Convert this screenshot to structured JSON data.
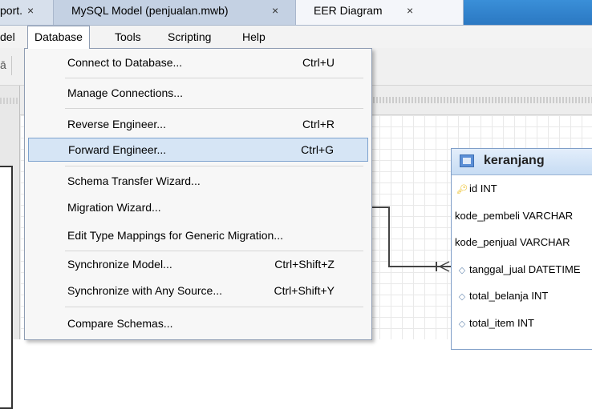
{
  "tabs": [
    {
      "label": "port.",
      "close": "×"
    },
    {
      "label": "MySQL Model (penjualan.mwb)",
      "close": "×"
    },
    {
      "label": "EER Diagram",
      "close": "×"
    }
  ],
  "menubar": {
    "items": [
      {
        "label": "del"
      },
      {
        "label": "Database"
      },
      {
        "label": "Tools"
      },
      {
        "label": "Scripting"
      },
      {
        "label": "Help"
      }
    ]
  },
  "toolbar": {
    "glyph": "ā"
  },
  "database_menu": {
    "items": [
      {
        "label": "Connect to Database...",
        "shortcut": "Ctrl+U"
      },
      {
        "label": "Manage Connections...",
        "shortcut": ""
      },
      {
        "label": "Reverse Engineer...",
        "shortcut": "Ctrl+R"
      },
      {
        "label": "Forward Engineer...",
        "shortcut": "Ctrl+G"
      },
      {
        "label": "Schema Transfer Wizard...",
        "shortcut": ""
      },
      {
        "label": "Migration Wizard...",
        "shortcut": ""
      },
      {
        "label": "Edit Type Mappings for Generic Migration...",
        "shortcut": ""
      },
      {
        "label": "Synchronize Model...",
        "shortcut": "Ctrl+Shift+Z"
      },
      {
        "label": "Synchronize with Any Source...",
        "shortcut": "Ctrl+Shift+Y"
      },
      {
        "label": "Compare Schemas...",
        "shortcut": ""
      }
    ],
    "highlighted": "Forward Engineer..."
  },
  "entity": {
    "title": "keranjang",
    "columns": [
      {
        "icon": "key-icon",
        "text": "id INT"
      },
      {
        "icon": "none",
        "text": "kode_pembeli VARCHAR"
      },
      {
        "icon": "none",
        "text": "kode_penjual VARCHAR"
      },
      {
        "icon": "diamond-icon",
        "text": "tanggal_jual DATETIME"
      },
      {
        "icon": "diamond-icon",
        "text": "total_belanja INT"
      },
      {
        "icon": "diamond-icon",
        "text": "total_item INT"
      }
    ]
  },
  "colors": {
    "selection_bg": "#d6e5f5",
    "selection_border": "#7da2ce",
    "entity_header": "#c7dcf3",
    "tab_active_bg": "#f4f6fa",
    "tab_fill": "#2b78c2"
  }
}
